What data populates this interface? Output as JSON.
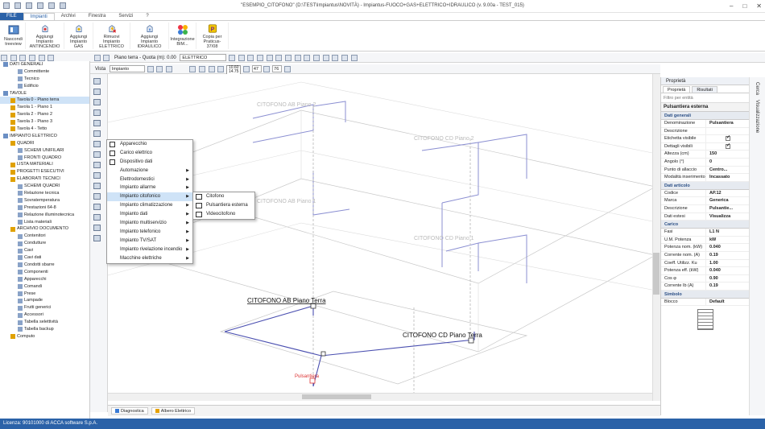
{
  "window": {
    "title": "\"ESEMPIO_CITOFONO\" (D:\\TEST\\Impiantus\\NOVITÀ) - Impiantus-FUOCO+GAS+ELETTRICO+IDRAULICO (v. 9.00a - TEST_015)"
  },
  "menu": [
    "FILE",
    "Impianti",
    "Archivi",
    "Finestra",
    "Servizi",
    "?"
  ],
  "ribbon": [
    {
      "label": "Nascondi treeview",
      "icon": "treeview-icon"
    },
    {
      "label": "Aggiungi Impianto ANTINCENDIO",
      "icon": "fire-system-icon"
    },
    {
      "label": "Aggiungi Impianto GAS",
      "icon": "gas-system-icon"
    },
    {
      "label": "Rimuovi Impianto ELETTRICO",
      "icon": "remove-electric-icon"
    },
    {
      "label": "Aggiungi Impianto IDRAULICO",
      "icon": "water-system-icon"
    },
    {
      "label": "Integrazione BIM...",
      "icon": "bim-icon"
    },
    {
      "label": "Copia per Praticus-37/08",
      "icon": "praticus-icon"
    }
  ],
  "toolbar": {
    "floor": "Piano terra - Quota (m): 0.00",
    "layer": "ELETTRICO",
    "view_label": "Vista",
    "view_value": "Impianto",
    "coord_a": "10.60",
    "coord_b": "14.75",
    "angle_a": "47",
    "angle_b": "76"
  },
  "tree": [
    {
      "label": "DATI GENERALI",
      "level": 0
    },
    {
      "label": "Committente",
      "level": 2
    },
    {
      "label": "Tecnico",
      "level": 2
    },
    {
      "label": "Edificio",
      "level": 2
    },
    {
      "label": "TAVOLE",
      "level": 0
    },
    {
      "label": "Tavola 0 - Piano terra",
      "level": 1
    },
    {
      "label": "Tavola 1 - Piano 1",
      "level": 1
    },
    {
      "label": "Tavola 2 - Piano 2",
      "level": 1
    },
    {
      "label": "Tavola 3 - Piano 3",
      "level": 1
    },
    {
      "label": "Tavola 4 - Tetto",
      "level": 1
    },
    {
      "label": "IMPIANTO ELETTRICO",
      "level": 0
    },
    {
      "label": "QUADRI",
      "level": 1
    },
    {
      "label": "SCHEMI UNIFILARI",
      "level": 2
    },
    {
      "label": "FRONTI QUADRO",
      "level": 2
    },
    {
      "label": "LISTA MATERIALI",
      "level": 1
    },
    {
      "label": "PROGETTI ESECUTIVI",
      "level": 1
    },
    {
      "label": "ELABORATI TECNICI",
      "level": 1
    },
    {
      "label": "SCHEMI QUADRI",
      "level": 2
    },
    {
      "label": "Relazione tecnica",
      "level": 2
    },
    {
      "label": "Sovratemperatura",
      "level": 2
    },
    {
      "label": "Prestazioni 64-8",
      "level": 2
    },
    {
      "label": "Relazione illuminotecnica",
      "level": 2
    },
    {
      "label": "Lista materiali",
      "level": 2
    },
    {
      "label": "ARCHIVIO DOCUMENTO",
      "level": 1
    },
    {
      "label": "Contenitori",
      "level": 2
    },
    {
      "label": "Condutture",
      "level": 2
    },
    {
      "label": "Cavi",
      "level": 2
    },
    {
      "label": "Cavi dati",
      "level": 2
    },
    {
      "label": "Condotti sbarre",
      "level": 2
    },
    {
      "label": "Componenti",
      "level": 2
    },
    {
      "label": "Apparecchi",
      "level": 2
    },
    {
      "label": "Comandi",
      "level": 2
    },
    {
      "label": "Prese",
      "level": 2
    },
    {
      "label": "Lampade",
      "level": 2
    },
    {
      "label": "Frutti generici",
      "level": 2
    },
    {
      "label": "Accessori",
      "level": 2
    },
    {
      "label": "Tabella selettività",
      "level": 2
    },
    {
      "label": "Tabella backup",
      "level": 2
    },
    {
      "label": "Computo",
      "level": 1
    }
  ],
  "context_menu": [
    {
      "label": "Apparecchio",
      "icon": true,
      "arrow": false
    },
    {
      "label": "Carico elettrico",
      "icon": true,
      "arrow": false
    },
    {
      "label": "Dispositivo dati",
      "icon": true,
      "arrow": false
    },
    {
      "label": "Automazione",
      "icon": false,
      "arrow": true
    },
    {
      "label": "Elettrodomestici",
      "icon": false,
      "arrow": true
    },
    {
      "label": "Impianto allarme",
      "icon": false,
      "arrow": true
    },
    {
      "label": "Impianto citofonico",
      "icon": false,
      "arrow": true,
      "selected": true
    },
    {
      "label": "Impianto climatizzazione",
      "icon": false,
      "arrow": true
    },
    {
      "label": "Impianto dati",
      "icon": false,
      "arrow": true
    },
    {
      "label": "Impianto multiservizio",
      "icon": false,
      "arrow": true
    },
    {
      "label": "Impianto telefonico",
      "icon": false,
      "arrow": true
    },
    {
      "label": "Impianto TV/SAT",
      "icon": false,
      "arrow": true
    },
    {
      "label": "Impianto rivelazione incendio",
      "icon": false,
      "arrow": true
    },
    {
      "label": "Macchine elettriche",
      "icon": false,
      "arrow": true
    }
  ],
  "submenu": [
    "Citofono",
    "Pulsantiera esterna",
    "Videocitofono"
  ],
  "canvas_labels": {
    "cito_ab_t": "CITOFONO AB Piano Terra",
    "cito_cd_t": "CITOFONO CD Piano Terra",
    "cito_ab_1": "CITOFONO AB Piano 1",
    "cito_cd_1": "CITOFONO CD Piano 1",
    "cito_ab_2": "CITOFONO AB Piano 2",
    "cito_cd_2": "CITOFONO CD Piano 2",
    "pulsantiera": "Pulsantiera"
  },
  "bottom_tabs": [
    "Diagnostica",
    "Albero Elettrico"
  ],
  "status": "Licenza: 90101000 di ACCA software S.p.A.",
  "properties": {
    "header": "Proprietà",
    "tabs": [
      "Proprietà",
      "Risultati"
    ],
    "filter": "Filtro per entità",
    "entity": "Pulsantiera esterna",
    "sections": [
      {
        "title": "Dati generali",
        "rows": [
          {
            "k": "Denominazione",
            "v": "Pulsantiera"
          },
          {
            "k": "Descrizione",
            "v": ""
          },
          {
            "k": "Etichetta visibile",
            "v": "",
            "check": true
          },
          {
            "k": "Dettagli visibili",
            "v": "",
            "check": true
          },
          {
            "k": "Altezza (cm)",
            "v": "150"
          },
          {
            "k": "Angolo (°)",
            "v": "0"
          },
          {
            "k": "Punto di allaccio",
            "v": "Centro..."
          },
          {
            "k": "Modalità inserimento",
            "v": "Incassato"
          }
        ]
      },
      {
        "title": "Dati articolo",
        "rows": [
          {
            "k": "Codice",
            "v": "AP.12"
          },
          {
            "k": "Marca",
            "v": "Generica"
          },
          {
            "k": "Descrizione",
            "v": "Pulsantie..."
          },
          {
            "k": "Dati estesi",
            "v": "Visualizza"
          }
        ]
      },
      {
        "title": "Carico",
        "rows": [
          {
            "k": "Fasi",
            "v": "L1 N"
          },
          {
            "k": "U.M. Potenza",
            "v": "kW"
          },
          {
            "k": "Potenza nom. (kW)",
            "v": "0.040"
          },
          {
            "k": "Corrente nom. (A)",
            "v": "0.19"
          },
          {
            "k": "Coeff. Utilizz. Ku",
            "v": "1.00"
          },
          {
            "k": "Potenza eff. (kW)",
            "v": "0.040"
          },
          {
            "k": "Cos φ",
            "v": "0.90"
          },
          {
            "k": "Corrente Ib (A)",
            "v": "0.19"
          }
        ]
      },
      {
        "title": "Simbolo",
        "rows": [
          {
            "k": "Blocco",
            "v": "Default"
          }
        ]
      }
    ]
  },
  "side_rail": [
    "Cerca",
    "Visualizzazione"
  ]
}
